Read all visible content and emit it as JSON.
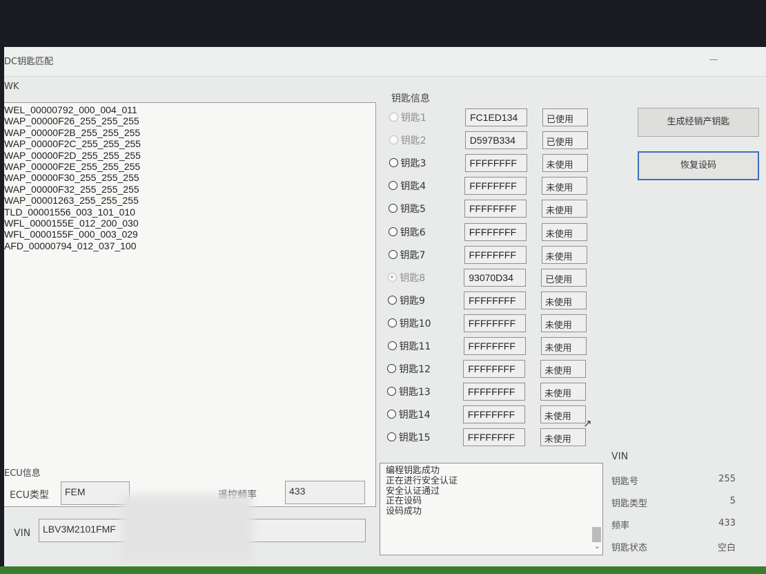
{
  "window": {
    "title": "DC钥匙匹配"
  },
  "wk_group": {
    "label": "WK"
  },
  "list_items": [
    "WEL_00000792_000_004_011",
    "WAP_00000F26_255_255_255",
    "WAP_00000F2B_255_255_255",
    "WAP_00000F2C_255_255_255",
    "WAP_00000F2D_255_255_255",
    "WAP_00000F2E_255_255_255",
    "WAP_00000F30_255_255_255",
    "WAP_00000F32_255_255_255",
    "WAP_00001263_255_255_255",
    "TLD_00001556_003_101_010",
    "WFL_0000155E_012_200_030",
    "WFL_0000155F_000_003_029",
    "AFD_00000794_012_037_100"
  ],
  "key_info": {
    "label": "钥匙信息",
    "keys": [
      {
        "name": "钥匙1",
        "code": "FC1ED134",
        "status": "已使用",
        "disabled": true
      },
      {
        "name": "钥匙2",
        "code": "D597B334",
        "status": "已使用",
        "disabled": true
      },
      {
        "name": "钥匙3",
        "code": "FFFFFFFF",
        "status": "未使用",
        "disabled": false
      },
      {
        "name": "钥匙4",
        "code": "FFFFFFFF",
        "status": "未使用",
        "disabled": false
      },
      {
        "name": "钥匙5",
        "code": "FFFFFFFF",
        "status": "未使用",
        "disabled": false
      },
      {
        "name": "钥匙6",
        "code": "FFFFFFFF",
        "status": "未使用",
        "disabled": false
      },
      {
        "name": "钥匙7",
        "code": "FFFFFFFF",
        "status": "未使用",
        "disabled": false
      },
      {
        "name": "钥匙8",
        "code": "93070D34",
        "status": "已使用",
        "disabled": true
      },
      {
        "name": "钥匙9",
        "code": "FFFFFFFF",
        "status": "未使用",
        "disabled": false
      },
      {
        "name": "钥匙10",
        "code": "FFFFFFFF",
        "status": "未使用",
        "disabled": false
      },
      {
        "name": "钥匙11",
        "code": "FFFFFFFF",
        "status": "未使用",
        "disabled": false
      },
      {
        "name": "钥匙12",
        "code": "FFFFFFFF",
        "status": "未使用",
        "disabled": false
      },
      {
        "name": "钥匙13",
        "code": "FFFFFFFF",
        "status": "未使用",
        "disabled": false
      },
      {
        "name": "钥匙14",
        "code": "FFFFFFFF",
        "status": "未使用",
        "disabled": false
      },
      {
        "name": "钥匙15",
        "code": "FFFFFFFF",
        "status": "未使用",
        "disabled": false
      }
    ]
  },
  "buttons": {
    "generate": "生成经销产钥匙",
    "restore": "恢复设码"
  },
  "ecu": {
    "label": "ECU信息",
    "type_label": "ECU类型",
    "type_value": "FEM",
    "freq_label": "遥控频率",
    "freq_value": "433",
    "vin_label": "VIN",
    "vin_value": "LBV3M2101FMF"
  },
  "log": {
    "lines": [
      "编程钥匙成功",
      "正在进行安全认证",
      "安全认证通过",
      "正在设码",
      "设码成功"
    ]
  },
  "vin_panel": {
    "title": "VIN",
    "rows": [
      {
        "label": "钥匙号",
        "value": "255"
      },
      {
        "label": "钥匙类型",
        "value": "5"
      },
      {
        "label": "频率",
        "value": "433"
      },
      {
        "label": "钥匙状态",
        "value": "空白"
      }
    ]
  }
}
